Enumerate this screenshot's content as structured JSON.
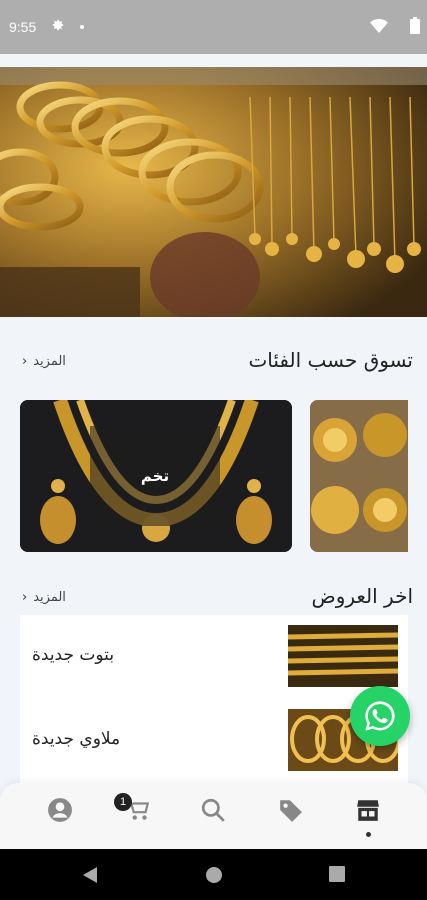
{
  "status_bar": {
    "time": "9:55",
    "icons": [
      "gear-icon",
      "notification-dot",
      "wifi-icon",
      "battery-icon"
    ]
  },
  "hero": {
    "image": "gold-jewelry-shop-banner"
  },
  "categories_section": {
    "title": "تسوق حسب الفئات",
    "more_label": "المزيد",
    "items": [
      {
        "label": "تخم",
        "image": "gold-necklace-set"
      },
      {
        "label": "",
        "image": "gold-coins-pendants"
      }
    ]
  },
  "offers_section": {
    "title": "اخر العروض",
    "more_label": "المزيد",
    "items": [
      {
        "name": "بتوت جديدة",
        "image": "gold-bangles-stack"
      },
      {
        "name": "ملاوي جديدة",
        "image": "gold-twisted-bangles"
      }
    ]
  },
  "whatsapp": {
    "icon": "whatsapp-icon"
  },
  "bottom_nav": {
    "items": [
      "profile-icon",
      "cart-icon",
      "search-icon",
      "tag-icon",
      "store-icon"
    ],
    "cart_badge": "1",
    "active": "store-icon"
  },
  "colors": {
    "background": "#f1f4f9",
    "whatsapp": "#25d366",
    "gold": "#c9962a"
  }
}
